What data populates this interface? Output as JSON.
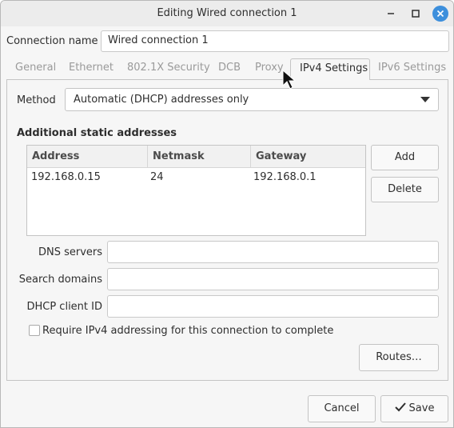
{
  "window": {
    "title": "Editing Wired connection 1"
  },
  "connection": {
    "label": "Connection name",
    "value": "Wired connection 1"
  },
  "tabs": [
    {
      "label": "General",
      "active": false
    },
    {
      "label": "Ethernet",
      "active": false
    },
    {
      "label": "802.1X Security",
      "active": false
    },
    {
      "label": "DCB",
      "active": false
    },
    {
      "label": "Proxy",
      "active": false
    },
    {
      "label": "IPv4 Settings",
      "active": true
    },
    {
      "label": "IPv6 Settings",
      "active": false
    }
  ],
  "method": {
    "label": "Method",
    "value": "Automatic (DHCP) addresses only"
  },
  "addresses": {
    "heading": "Additional static addresses",
    "columns": [
      "Address",
      "Netmask",
      "Gateway"
    ],
    "rows": [
      [
        "192.168.0.15",
        "24",
        "192.168.0.1"
      ]
    ],
    "add_label": "Add",
    "delete_label": "Delete"
  },
  "fields": {
    "dns_label": "DNS servers",
    "dns_value": "",
    "search_label": "Search domains",
    "search_value": "",
    "dhcp_label": "DHCP client ID",
    "dhcp_value": ""
  },
  "require": {
    "label": "Require IPv4 addressing for this connection to complete",
    "checked": false
  },
  "routes_label": "Routes…",
  "footer": {
    "cancel_label": "Cancel",
    "save_label": "Save"
  },
  "colors": {
    "accent": "#3d8fdc",
    "tab_inactive": "#9a9a9a"
  },
  "icons": [
    "minimize-icon",
    "maximize-icon",
    "close-icon",
    "dropdown-arrow-icon",
    "checkmark-icon",
    "mouse-pointer-icon"
  ]
}
